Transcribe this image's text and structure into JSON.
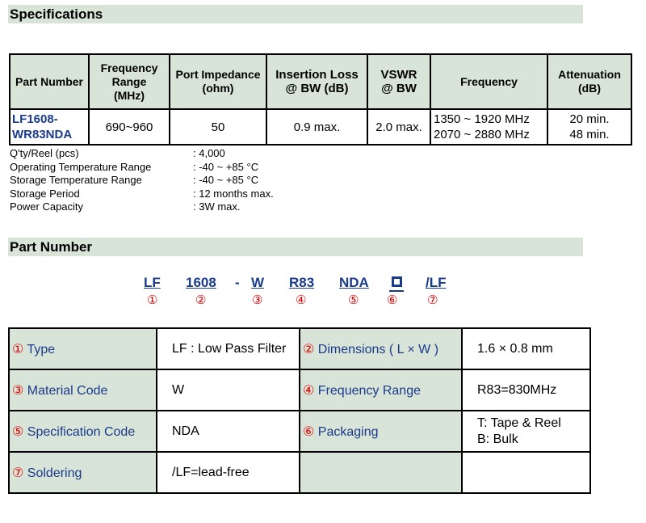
{
  "spec_section": {
    "title": "Specifications"
  },
  "spec_table": {
    "headers": {
      "part_number": "Part Number",
      "freq_range": [
        "Frequency",
        "Range",
        "(MHz)"
      ],
      "port_impedance": [
        "Port Impedance",
        "(ohm)"
      ],
      "insertion_loss": [
        "Insertion Loss",
        "@ BW (dB)"
      ],
      "vswr": [
        "VSWR",
        "@ BW"
      ],
      "frequency": "Frequency",
      "attenuation": [
        "Attenuation",
        "(dB)"
      ]
    },
    "row": {
      "part_number": [
        "LF1608-",
        "WR83NDA"
      ],
      "freq_range": "690~960",
      "port_impedance": "50",
      "insertion_loss": "0.9 max.",
      "vswr": "2.0 max.",
      "frequency": [
        "1350 ~ 1920 MHz",
        "2070 ~ 2880 MHz"
      ],
      "attenuation": [
        "20 min.",
        "48 min."
      ]
    }
  },
  "properties": [
    {
      "label": "Q'ty/Reel (pcs)",
      "value": ": 4,000"
    },
    {
      "label": "Operating Temperature Range",
      "value": ": -40 ~ +85 °C"
    },
    {
      "label": "Storage Temperature Range",
      "value": ": -40 ~ +85 °C"
    },
    {
      "label": "Storage Period",
      "value": ": 12 months max."
    },
    {
      "label": "Power Capacity",
      "value": ": 3W max."
    }
  ],
  "pn_section": {
    "title": "Part Number"
  },
  "code": {
    "segments": [
      "LF",
      "1608",
      "-",
      "W",
      "R83",
      "NDA",
      "/LF"
    ],
    "markers": [
      "①",
      "②",
      "③",
      "④",
      "⑤",
      "⑥",
      "⑦"
    ]
  },
  "pn_table": {
    "type": {
      "marker": "①",
      "label": "Type",
      "value": "LF : Low Pass Filter"
    },
    "dimensions": {
      "marker": "②",
      "label": "Dimensions ( L × W )",
      "value": "1.6 × 0.8 mm"
    },
    "material": {
      "marker": "③",
      "label": "Material Code",
      "value": "W"
    },
    "frequency_range": {
      "marker": "④",
      "label": "Frequency Range",
      "value": "R83=830MHz"
    },
    "spec_code": {
      "marker": "⑤",
      "label": "Specification Code",
      "value": "NDA"
    },
    "packaging": {
      "marker": "⑥",
      "label": "Packaging",
      "value": [
        "T: Tape & Reel",
        "B: Bulk"
      ]
    },
    "soldering": {
      "marker": "⑦",
      "label": "Soldering",
      "value": "/LF=lead-free"
    }
  }
}
